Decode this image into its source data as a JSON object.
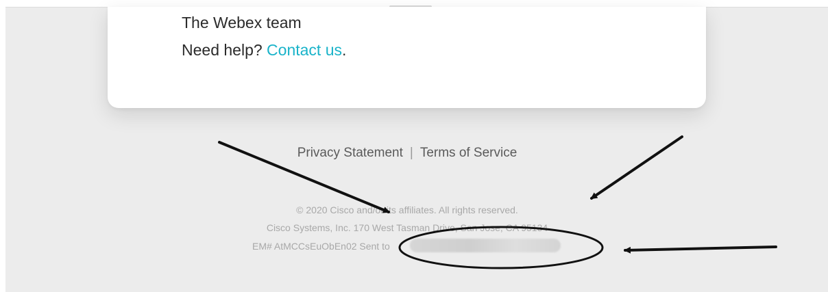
{
  "email": {
    "signature": {
      "team": "The Webex team",
      "help_prefix": "Need help? ",
      "contact_link": "Contact us",
      "help_suffix": "."
    },
    "footer": {
      "privacy_link": "Privacy Statement",
      "separator": "|",
      "terms_link": "Terms of Service",
      "copyright": "© 2020 Cisco and/or its affiliates. All rights reserved.",
      "address": "Cisco Systems, Inc. 170 West Tasman Drive, San Jose, CA 95134",
      "tracking": "EM# AtMCCsEuObEn02 Sent to"
    }
  },
  "colors": {
    "link": "#19b3c9",
    "background": "#ececec",
    "card": "#ffffff",
    "annotation": "#111111"
  }
}
